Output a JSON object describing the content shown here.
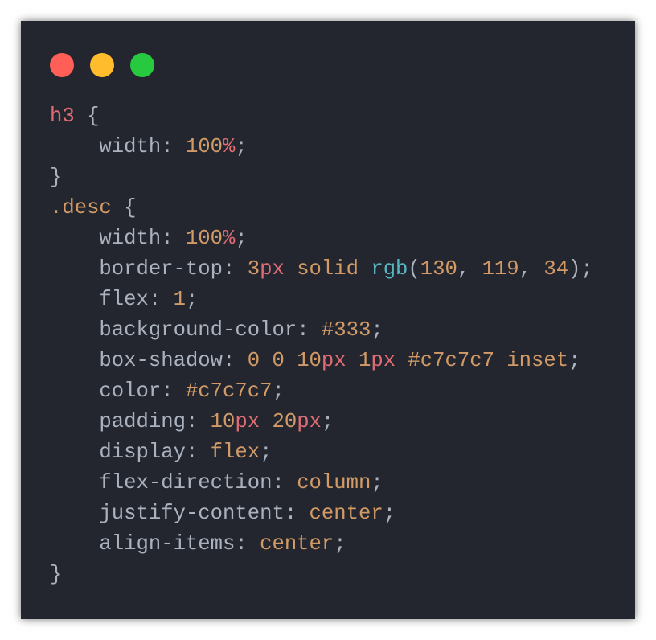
{
  "window": {
    "controls": [
      {
        "name": "window-close-button",
        "color": "#ff5f56"
      },
      {
        "name": "window-minimize-button",
        "color": "#ffbd2e"
      },
      {
        "name": "window-maximize-button",
        "color": "#27c93f"
      }
    ]
  },
  "theme": {
    "background": "#23262e",
    "token_colors": {
      "tag": "#e06c75",
      "class": "#d19a66",
      "punct": "#abb2bf",
      "plain": "#abb2bf",
      "property": "#abb2bf",
      "number": "#d19a66",
      "unit": "#e06c75",
      "keyword": "#d19a66",
      "function": "#56b6c2",
      "hex": "#d19a66"
    }
  },
  "code": {
    "lines": [
      {
        "tokens": [
          {
            "text": "h3",
            "kind": "tag"
          },
          {
            "text": " {",
            "kind": "punct"
          }
        ]
      },
      {
        "tokens": [
          {
            "text": "    width",
            "kind": "property"
          },
          {
            "text": ": ",
            "kind": "punct"
          },
          {
            "text": "100",
            "kind": "number"
          },
          {
            "text": "%",
            "kind": "unit"
          },
          {
            "text": ";",
            "kind": "punct"
          }
        ]
      },
      {
        "tokens": [
          {
            "text": "}",
            "kind": "punct"
          }
        ]
      },
      {
        "tokens": [
          {
            "text": ".desc",
            "kind": "class"
          },
          {
            "text": " {",
            "kind": "punct"
          }
        ]
      },
      {
        "tokens": [
          {
            "text": "    width",
            "kind": "property"
          },
          {
            "text": ": ",
            "kind": "punct"
          },
          {
            "text": "100",
            "kind": "number"
          },
          {
            "text": "%",
            "kind": "unit"
          },
          {
            "text": ";",
            "kind": "punct"
          }
        ]
      },
      {
        "tokens": [
          {
            "text": "    border-top",
            "kind": "property"
          },
          {
            "text": ": ",
            "kind": "punct"
          },
          {
            "text": "3",
            "kind": "number"
          },
          {
            "text": "px",
            "kind": "unit"
          },
          {
            "text": " ",
            "kind": "plain"
          },
          {
            "text": "solid",
            "kind": "keyword"
          },
          {
            "text": " ",
            "kind": "plain"
          },
          {
            "text": "rgb",
            "kind": "function"
          },
          {
            "text": "(",
            "kind": "punct"
          },
          {
            "text": "130",
            "kind": "number"
          },
          {
            "text": ", ",
            "kind": "punct"
          },
          {
            "text": "119",
            "kind": "number"
          },
          {
            "text": ", ",
            "kind": "punct"
          },
          {
            "text": "34",
            "kind": "number"
          },
          {
            "text": ");",
            "kind": "punct"
          }
        ]
      },
      {
        "tokens": [
          {
            "text": "    flex",
            "kind": "property"
          },
          {
            "text": ": ",
            "kind": "punct"
          },
          {
            "text": "1",
            "kind": "number"
          },
          {
            "text": ";",
            "kind": "punct"
          }
        ]
      },
      {
        "tokens": [
          {
            "text": "    background-color",
            "kind": "property"
          },
          {
            "text": ": ",
            "kind": "punct"
          },
          {
            "text": "#333",
            "kind": "hex"
          },
          {
            "text": ";",
            "kind": "punct"
          }
        ]
      },
      {
        "tokens": [
          {
            "text": "    box-shadow",
            "kind": "property"
          },
          {
            "text": ": ",
            "kind": "punct"
          },
          {
            "text": "0",
            "kind": "number"
          },
          {
            "text": " ",
            "kind": "plain"
          },
          {
            "text": "0",
            "kind": "number"
          },
          {
            "text": " ",
            "kind": "plain"
          },
          {
            "text": "10",
            "kind": "number"
          },
          {
            "text": "px",
            "kind": "unit"
          },
          {
            "text": " ",
            "kind": "plain"
          },
          {
            "text": "1",
            "kind": "number"
          },
          {
            "text": "px",
            "kind": "unit"
          },
          {
            "text": " ",
            "kind": "plain"
          },
          {
            "text": "#c7c7c7",
            "kind": "hex"
          },
          {
            "text": " ",
            "kind": "plain"
          },
          {
            "text": "inset",
            "kind": "keyword"
          },
          {
            "text": ";",
            "kind": "punct"
          }
        ]
      },
      {
        "tokens": [
          {
            "text": "    color",
            "kind": "property"
          },
          {
            "text": ": ",
            "kind": "punct"
          },
          {
            "text": "#c7c7c7",
            "kind": "hex"
          },
          {
            "text": ";",
            "kind": "punct"
          }
        ]
      },
      {
        "tokens": [
          {
            "text": "    padding",
            "kind": "property"
          },
          {
            "text": ": ",
            "kind": "punct"
          },
          {
            "text": "10",
            "kind": "number"
          },
          {
            "text": "px",
            "kind": "unit"
          },
          {
            "text": " ",
            "kind": "plain"
          },
          {
            "text": "20",
            "kind": "number"
          },
          {
            "text": "px",
            "kind": "unit"
          },
          {
            "text": ";",
            "kind": "punct"
          }
        ]
      },
      {
        "tokens": [
          {
            "text": "    display",
            "kind": "property"
          },
          {
            "text": ": ",
            "kind": "punct"
          },
          {
            "text": "flex",
            "kind": "keyword"
          },
          {
            "text": ";",
            "kind": "punct"
          }
        ]
      },
      {
        "tokens": [
          {
            "text": "    flex-direction",
            "kind": "property"
          },
          {
            "text": ": ",
            "kind": "punct"
          },
          {
            "text": "column",
            "kind": "keyword"
          },
          {
            "text": ";",
            "kind": "punct"
          }
        ]
      },
      {
        "tokens": [
          {
            "text": "    justify-content",
            "kind": "property"
          },
          {
            "text": ": ",
            "kind": "punct"
          },
          {
            "text": "center",
            "kind": "keyword"
          },
          {
            "text": ";",
            "kind": "punct"
          }
        ]
      },
      {
        "tokens": [
          {
            "text": "    align-items",
            "kind": "property"
          },
          {
            "text": ": ",
            "kind": "punct"
          },
          {
            "text": "center",
            "kind": "keyword"
          },
          {
            "text": ";",
            "kind": "punct"
          }
        ]
      },
      {
        "tokens": [
          {
            "text": "}",
            "kind": "punct"
          }
        ]
      }
    ]
  }
}
